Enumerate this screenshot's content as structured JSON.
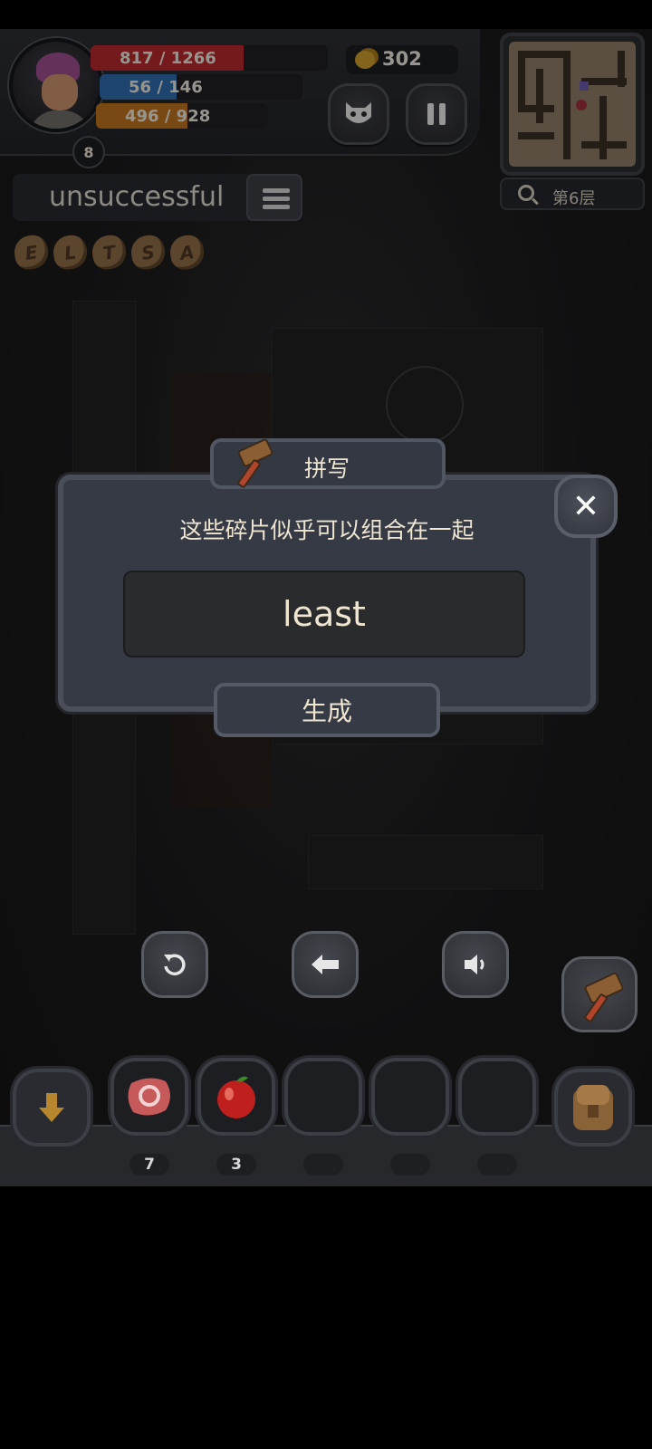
{
  "hud": {
    "hp": "817 / 1266",
    "mp": "56 / 146",
    "xp": "496 / 928",
    "hp_fraction": 0.645,
    "mp_fraction": 0.38,
    "xp_fraction": 0.53,
    "level": "8",
    "gold": "302",
    "colors": {
      "hp": "#b3282b",
      "mp": "#2d6aa8",
      "xp": "#b8701e"
    }
  },
  "minimap": {
    "floor_label": "第6层"
  },
  "word_panel": {
    "current_word": "unsuccessful",
    "letter_tiles": [
      "E",
      "L",
      "T",
      "S",
      "A"
    ]
  },
  "dialog": {
    "title": "拼写",
    "message": "这些碎片似乎可以组合在一起",
    "input_value": "least",
    "create_label": "生成"
  },
  "inventory": {
    "counts": [
      "7",
      "3"
    ]
  },
  "icons": [
    "mask-icon",
    "pause-icon",
    "search-icon",
    "list-icon",
    "hammer-icon",
    "close-icon",
    "undo-icon",
    "backspace-arrow-icon",
    "speaker-icon",
    "down-arrow-icon",
    "meat-icon",
    "apple-icon",
    "backpack-icon"
  ]
}
